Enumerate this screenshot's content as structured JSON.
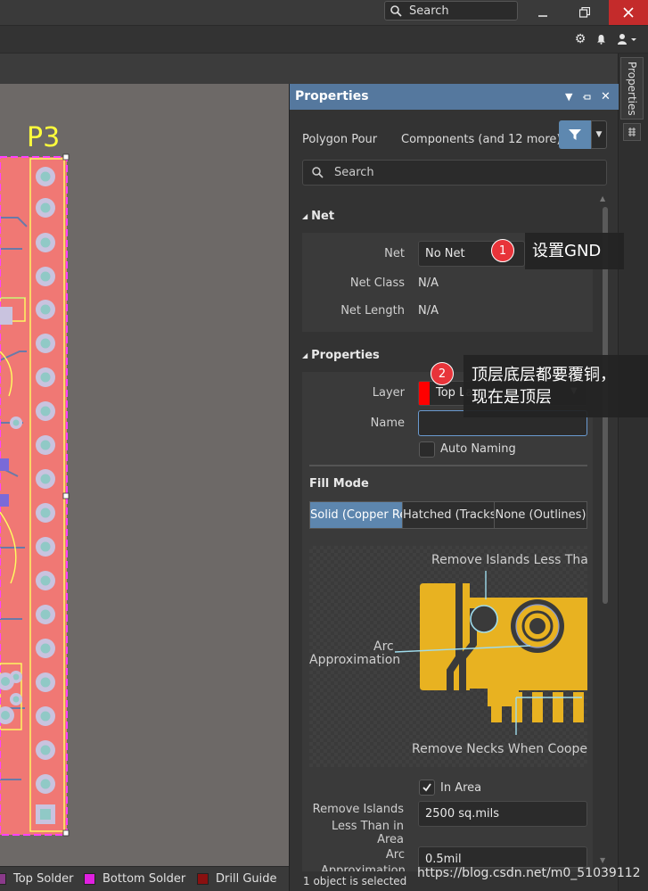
{
  "titlebar": {
    "search_placeholder": "Search",
    "minimize_icon": "minimize-icon",
    "maximize_icon": "restore-icon",
    "close_icon": "close-icon"
  },
  "toolbar": {
    "icons": [
      "gear-icon",
      "bell-icon",
      "user-icon"
    ]
  },
  "canvas": {
    "component_label": "P3"
  },
  "side_panel_tab": "Properties",
  "panel": {
    "title": "Properties",
    "object_type": "Polygon Pour",
    "filter_text": "Components (and 12 more)",
    "search_placeholder": "Search",
    "net_section": {
      "title": "Net",
      "net_label": "Net",
      "net_value": "No Net",
      "net_class_label": "Net Class",
      "net_class_value": "N/A",
      "net_length_label": "Net Length",
      "net_length_value": "N/A"
    },
    "properties_section": {
      "title": "Properties",
      "layer_label": "Layer",
      "layer_value": "Top Layer",
      "layer_color": "#ff0000",
      "name_label": "Name",
      "name_value": "",
      "auto_naming_label": "Auto Naming",
      "auto_naming_checked": false
    },
    "fill_mode": {
      "title": "Fill Mode",
      "options": [
        "Solid (Copper Regions)",
        "Hatched (Tracks/Arcs)",
        "None (Outlines)"
      ],
      "selected": "Solid (Copper Regions)"
    },
    "diagram": {
      "remove_islands_label": "Remove Islands Less Than",
      "arc_label_1": "Arc",
      "arc_label_2": "Approximation",
      "remove_necks_label": "Remove Necks When Cooper"
    },
    "in_area_label": "In Area",
    "in_area_checked": true,
    "remove_islands_label_1": "Remove Islands",
    "remove_islands_label_2": "Less Than in Area",
    "remove_islands_value": "2500 sq.mils",
    "arc_label": "Arc",
    "arc_label_2": "Approximation",
    "arc_value": "0.5mil",
    "status": "1 object is selected"
  },
  "bottom_layers": [
    {
      "label": "Top Solder",
      "color": "#8a3a8a"
    },
    {
      "label": "Bottom Solder",
      "color": "#e020e0"
    },
    {
      "label": "Drill Guide",
      "color": "#8a1010"
    }
  ],
  "annotations": {
    "badge_1": "1",
    "callout_1": "设置GND",
    "badge_2": "2",
    "callout_2_line1": "顶层底层都要覆铜，",
    "callout_2_line2": "现在是顶层"
  },
  "watermark": "https://blog.csdn.net/m0_51039112"
}
